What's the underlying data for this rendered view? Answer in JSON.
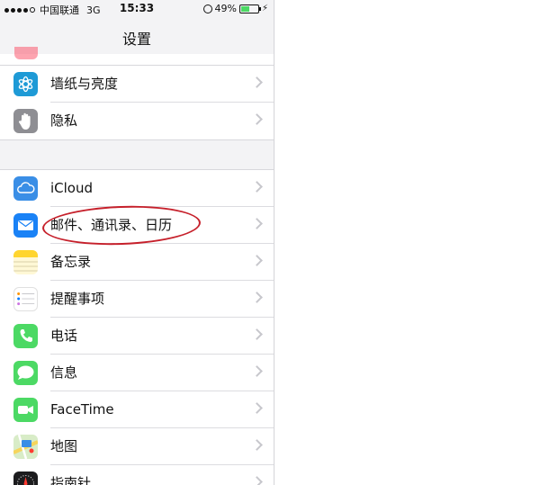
{
  "status_bar": {
    "carrier": "中国联通",
    "network": "3G",
    "time": "15:33",
    "battery_percent": "49%",
    "battery_level": 0.49
  },
  "nav": {
    "title": "设置"
  },
  "group1": [
    {
      "label": "墙纸与亮度",
      "icon": "wallpaper-icon",
      "color": "#1e9ad6"
    },
    {
      "label": "隐私",
      "icon": "hand-privacy-icon",
      "color": "#8e8e93"
    }
  ],
  "group2": [
    {
      "label": "iCloud",
      "icon": "icloud-icon",
      "color": "#3a8ee6"
    },
    {
      "label": "邮件、通讯录、日历",
      "icon": "mail-icon",
      "color": "#1a82f6"
    },
    {
      "label": "备忘录",
      "icon": "notes-icon",
      "color": "#ffd52e"
    },
    {
      "label": "提醒事项",
      "icon": "reminders-icon",
      "color": "#ffffff"
    },
    {
      "label": "电话",
      "icon": "phone-icon",
      "color": "#4cd964"
    },
    {
      "label": "信息",
      "icon": "messages-icon",
      "color": "#4cd964"
    },
    {
      "label": "FaceTime",
      "icon": "facetime-icon",
      "color": "#4cd964"
    },
    {
      "label": "地图",
      "icon": "maps-icon",
      "color": "#7fc4e8"
    },
    {
      "label": "指南针",
      "icon": "compass-icon",
      "color": "#1c1c1e"
    }
  ],
  "annotation": {
    "color": "#c6202b"
  }
}
